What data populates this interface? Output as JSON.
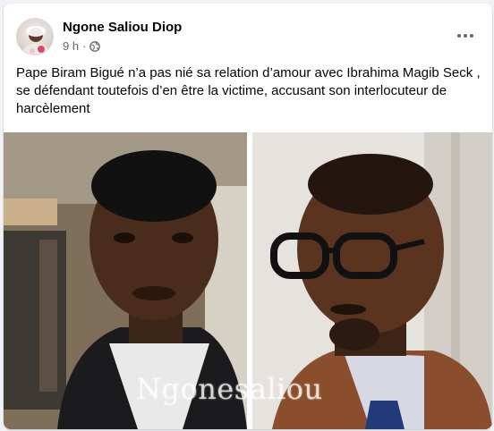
{
  "post": {
    "author": "Ngone Saliou Diop",
    "time": "9 h",
    "time_separator": "·",
    "privacy_icon": "globe-icon",
    "more_icon": "more-options-icon",
    "text": "Pape Biram Bigué n’a pas nié sa relation d’amour avec Ibrahima Magib  Seck , se défendant toutefois d’en être la victime, accusant son interlocuteur de harcèlement",
    "image": {
      "watermark": "Ngonesaliou"
    }
  },
  "colors": {
    "name_text": "#050505",
    "meta_text": "#65676b",
    "card_bg": "#ffffff",
    "page_bg": "#f0f2f5"
  }
}
